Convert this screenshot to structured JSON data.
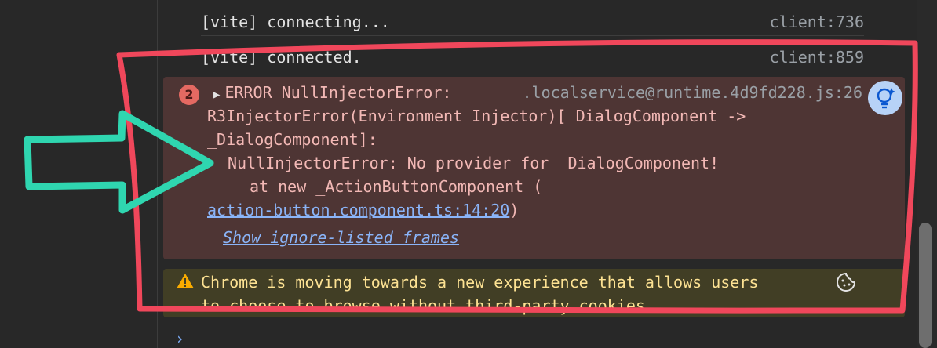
{
  "console": {
    "logs": [
      {
        "message": "[vite] connecting...",
        "source": "client:736"
      },
      {
        "message": "[vite] connected.",
        "source": "client:859"
      }
    ],
    "error": {
      "count": "2",
      "header": "ERROR NullInjectorError:",
      "source": ".localservice@runtime.4d9fd228.js:26",
      "line2": "R3InjectorError(Environment Injector)[_DialogComponent ->",
      "line3": "_DialogComponent]:",
      "line4": "NullInjectorError: No provider for _DialogComponent!",
      "line5": "at new _ActionButtonComponent (",
      "link": "action-button.component.ts:14:20",
      "link_suffix": ")",
      "ignore_link": "Show ignore-listed frames"
    },
    "warning": {
      "line1": "Chrome is moving towards a new experience that allows users",
      "line2": "to choose to browse without third-party cookies."
    },
    "prompt_symbol": "›"
  },
  "icons": {
    "error_badge": "error-count-badge",
    "expand": "expand-caret-icon",
    "insight": "lightbulb-insight-icon",
    "warning": "warning-triangle-icon",
    "cookie": "cookie-icon",
    "annotation_arrow": "arrow-annotation",
    "annotation_outline": "red-outline-annotation"
  },
  "colors": {
    "background": "#282828",
    "error_bg": "#4e3534",
    "error_text": "#f2b8b5",
    "warning_bg": "#413e25",
    "warning_text": "#fde293",
    "link": "#8ab4f8",
    "annotation_red": "#f0475b",
    "annotation_teal": "#2fd6b0"
  }
}
